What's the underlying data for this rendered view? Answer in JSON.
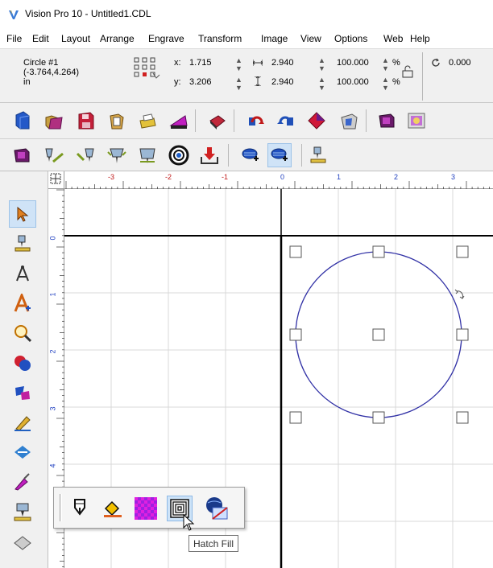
{
  "window": {
    "title": "Vision Pro 10 - Untitled1.CDL",
    "app_icon": "vision-pro-logo"
  },
  "menu": [
    "File",
    "Edit",
    "Layout",
    "Arrange",
    "Engrave",
    "Transform",
    "Image",
    "View",
    "Options",
    "Web",
    "Help"
  ],
  "properties": {
    "object_name": "Circle #1",
    "object_coords": "(-3.764,4.264)",
    "units": "in",
    "x_label": "x:",
    "x_value": "1.715",
    "y_label": "y:",
    "y_value": "3.206",
    "width_value": "2.940",
    "height_value": "2.940",
    "scale_x_value": "100.000",
    "scale_y_value": "100.000",
    "percent_sign": "%",
    "rotation_value": "0.000"
  },
  "ruler": {
    "horizontal_labels": [
      "-3",
      "-2",
      "-1",
      "0",
      "1",
      "2",
      "3"
    ],
    "vertical_labels": [
      "0",
      "1",
      "2",
      "3",
      "4"
    ]
  },
  "popup": {
    "tooltip": "Hatch Fill",
    "active_tool": "hatch-fill"
  },
  "colors": {
    "circle_stroke": "#3232a6",
    "grid": "#d9d9d9",
    "page_border": "#000000",
    "toolbar_bg": "#f0f0f0",
    "active_highlight": "#cfe3f7"
  }
}
